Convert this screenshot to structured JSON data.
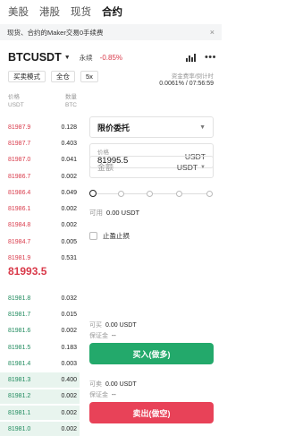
{
  "tabs": [
    {
      "label": "美股",
      "active": false
    },
    {
      "label": "港股",
      "active": false
    },
    {
      "label": "现货",
      "active": false
    },
    {
      "label": "合约",
      "active": true
    }
  ],
  "banner": {
    "text": "现货、合约的Maker交易0手续费",
    "close": "×"
  },
  "symbol": {
    "name": "BTCUSDT",
    "type": "永续",
    "change": "-0.85%"
  },
  "pills": [
    "买卖模式",
    "全仓",
    "5x"
  ],
  "funding": {
    "label": "资金费率/倒计时",
    "value": "0.0061% / 07:56:59"
  },
  "orderbook": {
    "price_label": "价格",
    "price_unit": "USDT",
    "qty_label": "数量",
    "qty_unit": "BTC",
    "asks": [
      {
        "price": "81987.9",
        "qty": "0.128"
      },
      {
        "price": "81987.7",
        "qty": "0.403"
      },
      {
        "price": "81987.0",
        "qty": "0.041"
      },
      {
        "price": "81986.7",
        "qty": "0.002"
      },
      {
        "price": "81986.4",
        "qty": "0.049"
      },
      {
        "price": "81986.1",
        "qty": "0.002"
      },
      {
        "price": "81984.8",
        "qty": "0.002"
      },
      {
        "price": "81984.7",
        "qty": "0.005"
      },
      {
        "price": "81981.9",
        "qty": "0.531"
      }
    ],
    "mid_price": "81993.5",
    "bids": [
      {
        "price": "81981.8",
        "qty": "0.032",
        "bg": false
      },
      {
        "price": "81981.7",
        "qty": "0.015",
        "bg": false
      },
      {
        "price": "81981.6",
        "qty": "0.002",
        "bg": false
      },
      {
        "price": "81981.5",
        "qty": "0.183",
        "bg": false
      },
      {
        "price": "81981.4",
        "qty": "0.003",
        "bg": false
      },
      {
        "price": "81981.3",
        "qty": "0.400",
        "bg": true
      },
      {
        "price": "81981.2",
        "qty": "0.002",
        "bg": true
      },
      {
        "price": "81981.1",
        "qty": "0.002",
        "bg": true
      },
      {
        "price": "81981.0",
        "qty": "0.002",
        "bg": true
      }
    ]
  },
  "form": {
    "order_type": "限价委托",
    "price_label": "价格",
    "price_value": "81995.5",
    "price_unit": "USDT",
    "amount_placeholder": "金额",
    "amount_unit": "USDT",
    "available_label": "可用",
    "available_value": "0.00 USDT",
    "tpsl_label": "止盈止损",
    "buy_open_label": "可买",
    "buy_open_value": "0.00 USDT",
    "buy_margin_label": "保证金",
    "buy_margin_value": "--",
    "buy_button": "买入(做多)",
    "sell_open_label": "可卖",
    "sell_open_value": "0.00 USDT",
    "sell_margin_label": "保证金",
    "sell_margin_value": "--",
    "sell_button": "卖出(做空)"
  },
  "colors": {
    "ask": "#d93a4a",
    "bid": "#1f8a5d",
    "buy": "#23a96b",
    "sell": "#e84258"
  }
}
